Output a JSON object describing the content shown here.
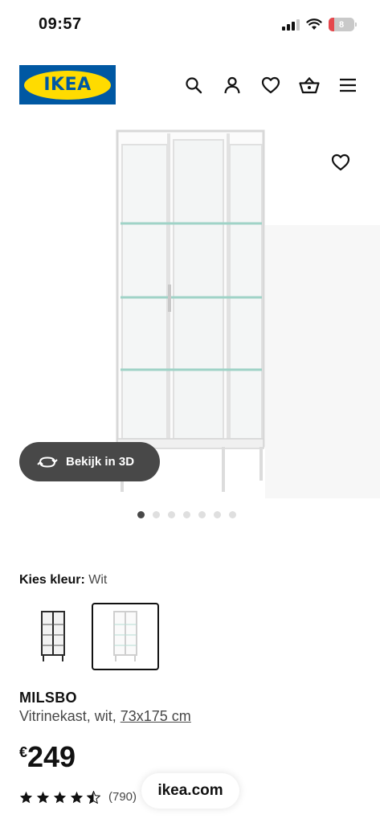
{
  "status_bar": {
    "time": "09:57",
    "battery": "8"
  },
  "header": {
    "logo_text": "IKEA",
    "icons": [
      "search-icon",
      "user-icon",
      "heart-icon",
      "basket-icon",
      "menu-icon"
    ]
  },
  "hero": {
    "view3d_label": "Bekijk in 3D",
    "image_count": 7,
    "active_image": 1
  },
  "colour": {
    "label": "Kies kleur:",
    "selected": "Wit"
  },
  "product": {
    "name": "MILSBO",
    "description_prefix": "Vitrinekast, wit, ",
    "size": "73x175 cm",
    "currency": "€",
    "price": "249",
    "rating_stars": 4.5,
    "review_count": "(790)"
  },
  "browser": {
    "domain": "ikea.com"
  },
  "colors": {
    "ikea_blue": "#0058a3",
    "ikea_yellow": "#ffdb00",
    "pill_gray": "#484848"
  }
}
